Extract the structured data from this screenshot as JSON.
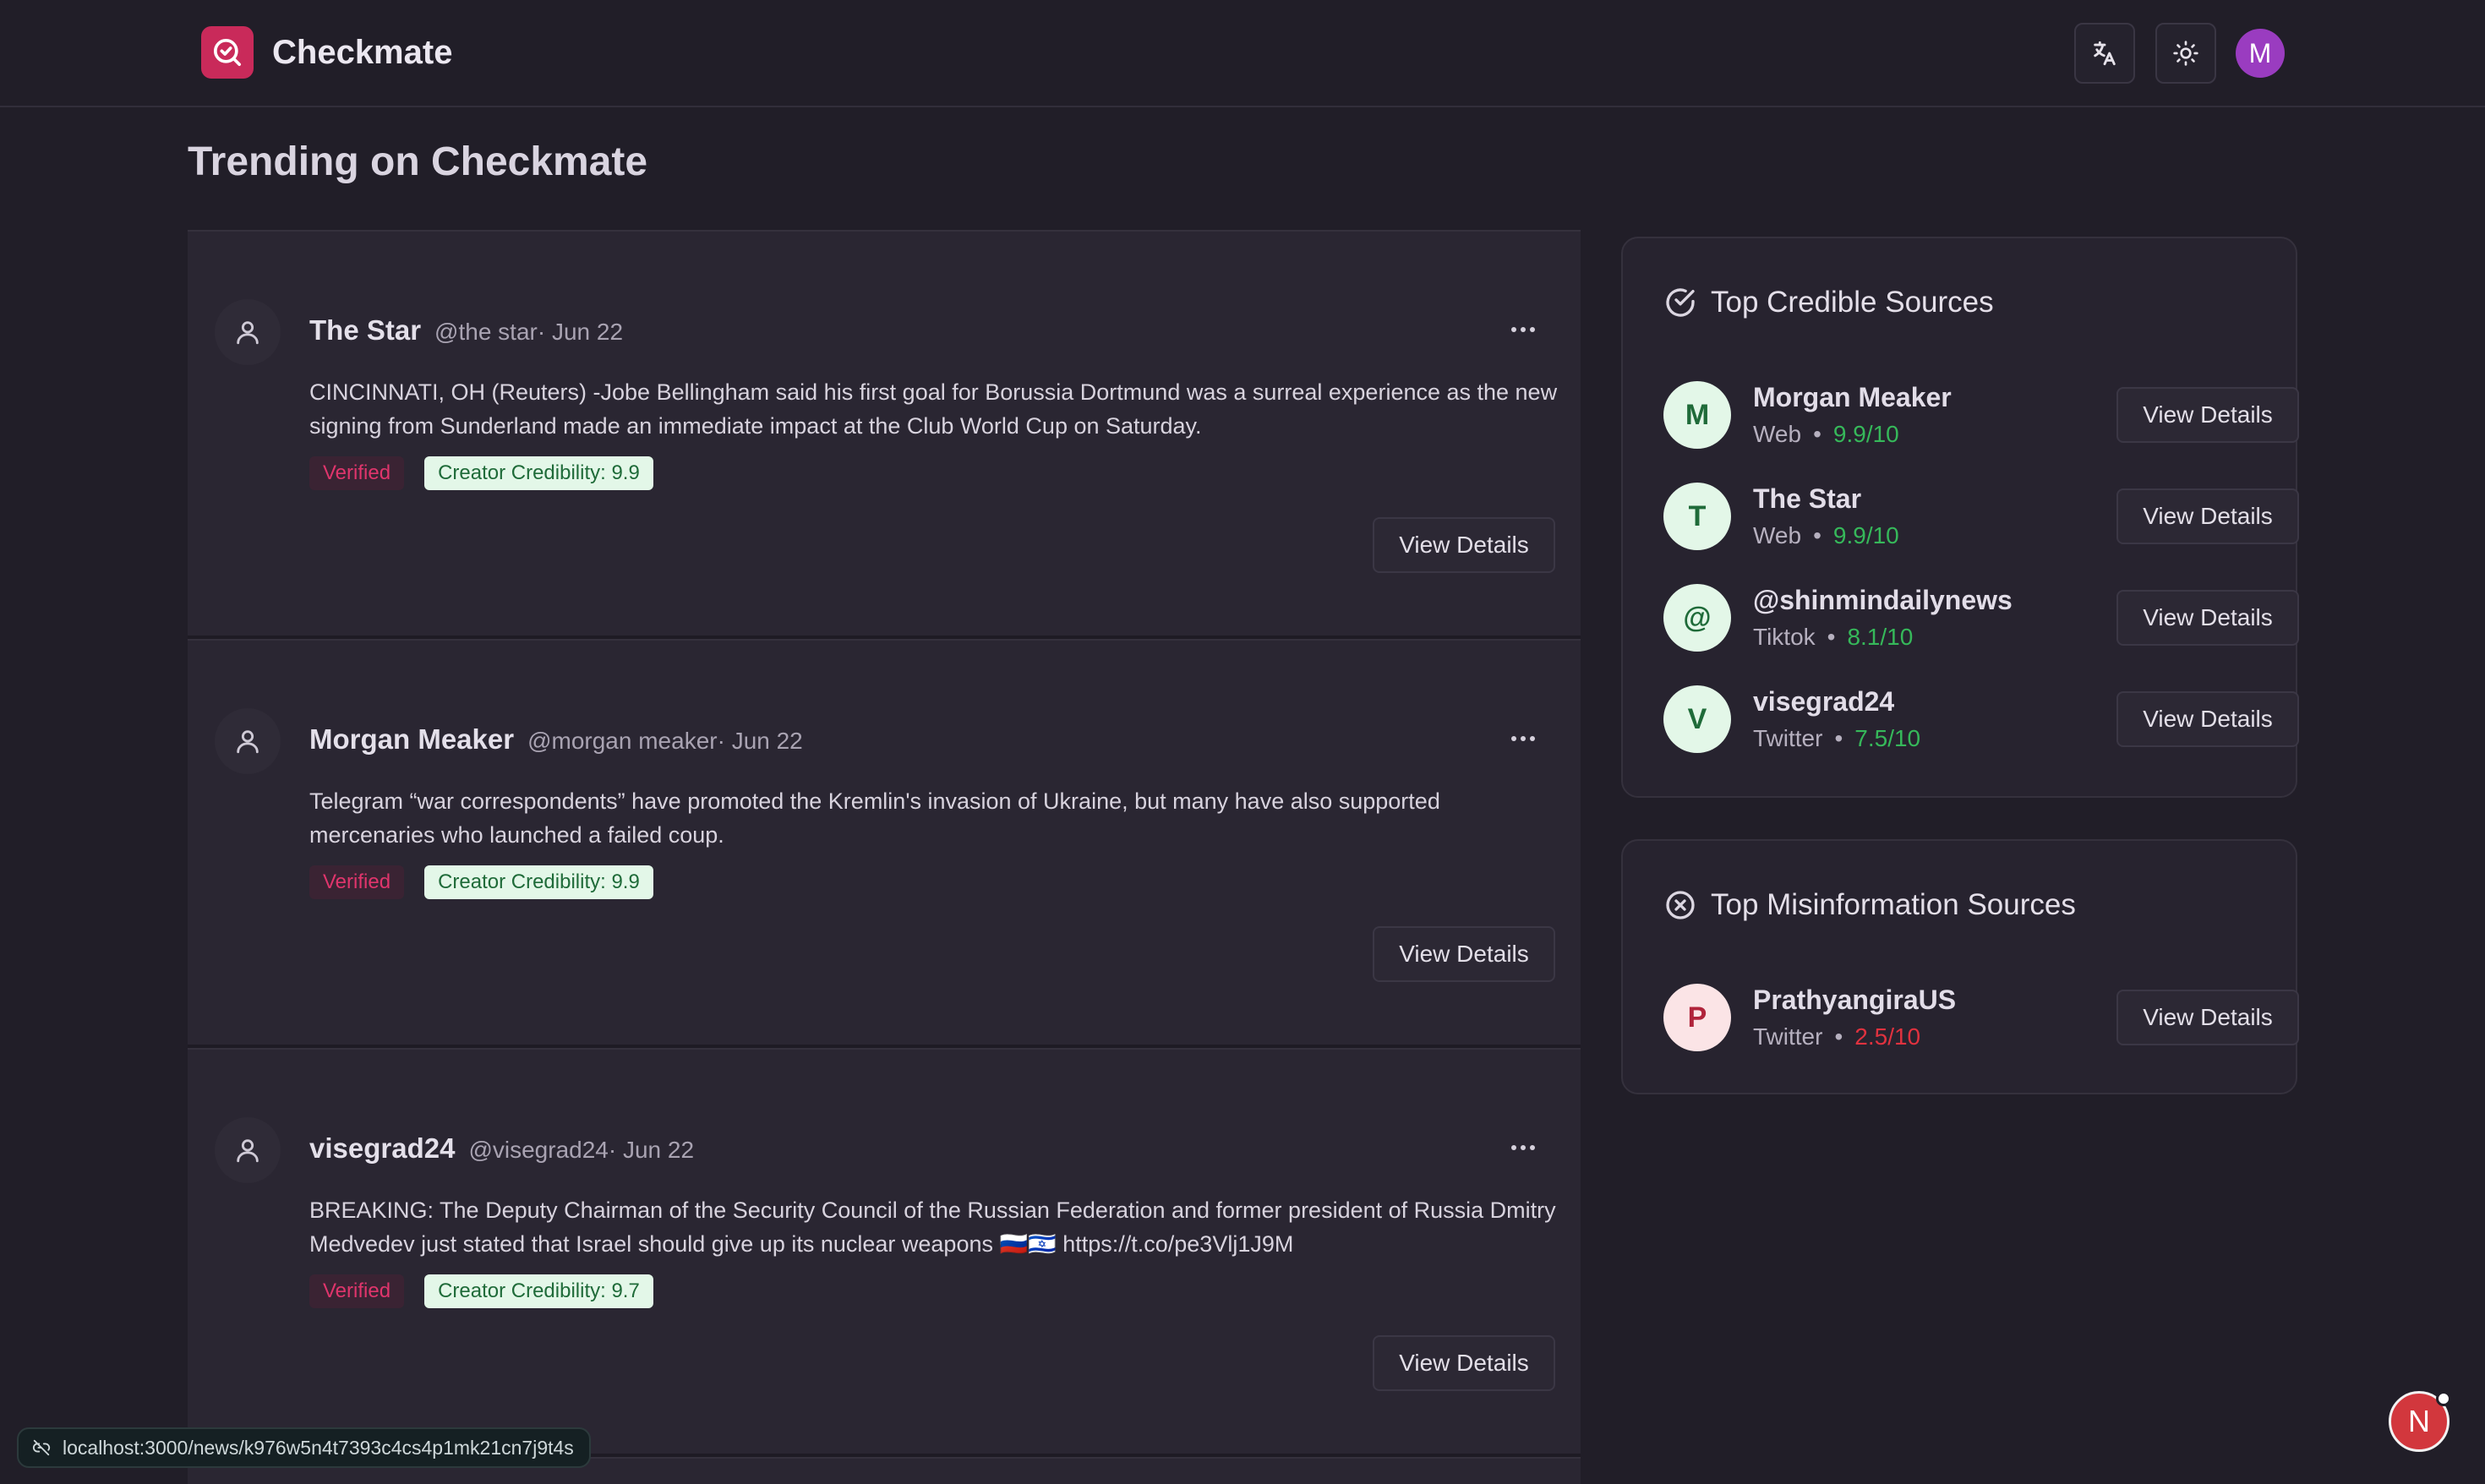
{
  "header": {
    "brand": "Checkmate",
    "avatar_initial": "M"
  },
  "page": {
    "title": "Trending on Checkmate"
  },
  "feed": [
    {
      "name": "The Star",
      "handle": "@the star· Jun 22",
      "body": "CINCINNATI, OH (Reuters) -Jobe Bellingham said his first goal for Borussia Dortmund was a surreal experience as the new signing from Sunderland made an immediate impact at the Club World Cup on Saturday.",
      "verified": "Verified",
      "credibility": "Creator Credibility: 9.9",
      "view": "View Details"
    },
    {
      "name": "Morgan Meaker",
      "handle": "@morgan meaker· Jun 22",
      "body": "Telegram “war correspondents” have promoted the Kremlin's invasion of Ukraine, but many have also supported mercenaries who launched a failed coup.",
      "verified": "Verified",
      "credibility": "Creator Credibility: 9.9",
      "view": "View Details"
    },
    {
      "name": "visegrad24",
      "handle": "@visegrad24· Jun 22",
      "body": "BREAKING: The Deputy Chairman of the Security Council of the Russian Federation and former president of Russia Dmitry Medvedev just stated that Israel should give up its nuclear weapons 🇷🇺🇮🇱 https://t.co/pe3Vlj1J9M",
      "verified": "Verified",
      "credibility": "Creator Credibility: 9.7",
      "view": "View Details"
    }
  ],
  "credible": {
    "title": "Top Credible Sources",
    "items": [
      {
        "initial": "M",
        "name": "Morgan Meaker",
        "platform": "Web",
        "dot": "•",
        "score": "9.9/10",
        "view": "View Details"
      },
      {
        "initial": "T",
        "name": "The Star",
        "platform": "Web",
        "dot": "•",
        "score": "9.9/10",
        "view": "View Details"
      },
      {
        "initial": "@",
        "name": "@shinmindailynews",
        "platform": "Tiktok",
        "dot": "•",
        "score": "8.1/10",
        "view": "View Details"
      },
      {
        "initial": "V",
        "name": "visegrad24",
        "platform": "Twitter",
        "dot": "•",
        "score": "7.5/10",
        "view": "View Details"
      }
    ]
  },
  "misinfo": {
    "title": "Top Misinformation Sources",
    "items": [
      {
        "initial": "P",
        "name": "PrathyangiraUS",
        "platform": "Twitter",
        "dot": "•",
        "score": "2.5/10",
        "view": "View Details"
      }
    ]
  },
  "status": {
    "url": "localhost:3000/news/k976w5n4t7393c4cs4p1mk21cn7j9t4s"
  },
  "fab": {
    "label": "N"
  },
  "colors": {
    "brand": "#c92a5a",
    "good": "#36b85a",
    "bad": "#e0323f",
    "background": "#211e28"
  }
}
